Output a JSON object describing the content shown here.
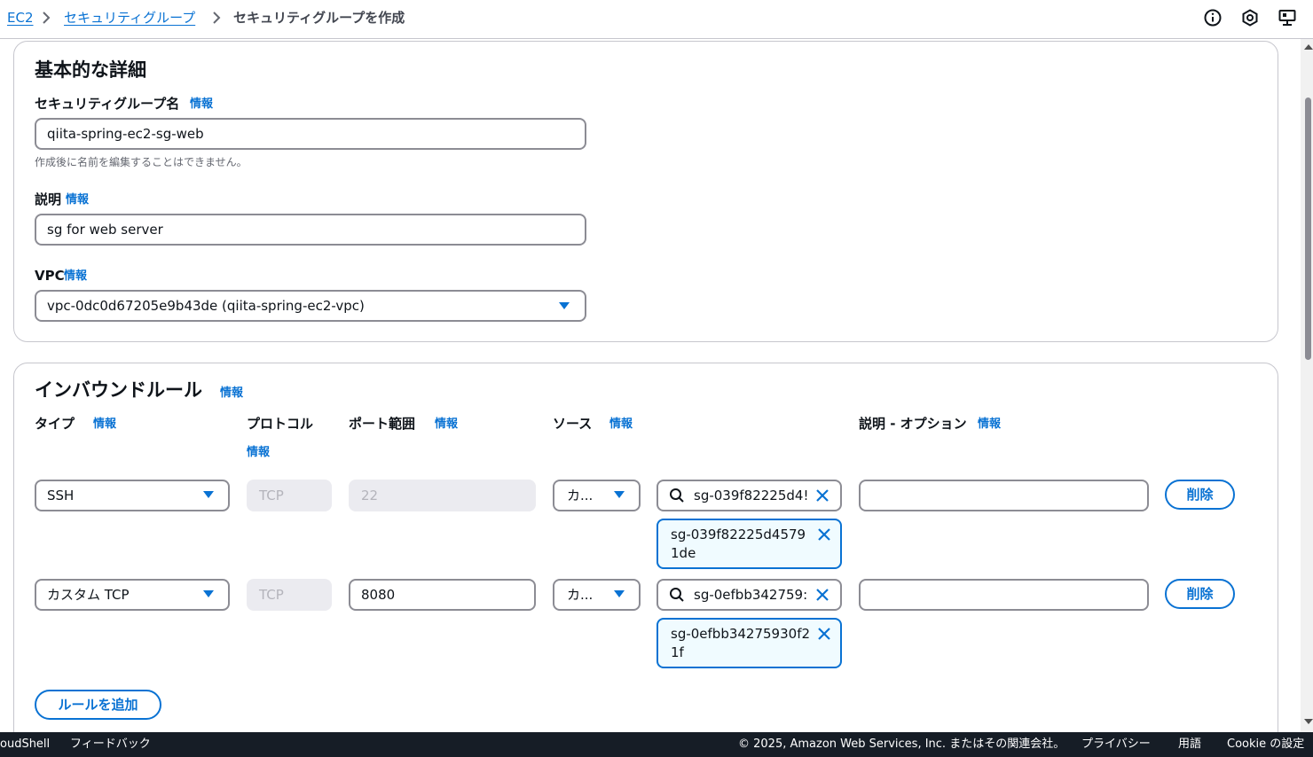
{
  "breadcrumb": {
    "items": [
      "EC2",
      "セキュリティグループ"
    ],
    "current": "セキュリティグループを作成"
  },
  "top_icons": [
    "info-circle-icon",
    "settings-hex-icon",
    "feedback-screen-icon"
  ],
  "basic_details": {
    "title": "基本的な詳細",
    "name_label": "セキュリティグループ名",
    "name_info": "情報",
    "name_value": "qiita-spring-ec2-sg-web",
    "name_hint": "作成後に名前を編集することはできません。",
    "desc_label": "説明",
    "desc_info": "情報",
    "desc_value": "sg for web server",
    "vpc_label": "VPC",
    "vpc_info": "情報",
    "vpc_value": "vpc-0dc0d67205e9b43de (qiita-spring-ec2-vpc)"
  },
  "inbound": {
    "title": "インバウンドルール",
    "title_info": "情報",
    "columns": {
      "type": "タイプ",
      "type_info": "情報",
      "protocol": "プロトコル",
      "protocol_info": "情報",
      "port": "ポート範囲",
      "port_info": "情報",
      "source": "ソース",
      "source_info": "情報",
      "desc": "説明 - オプション",
      "desc_info": "情報"
    },
    "rules": [
      {
        "type": "SSH",
        "protocol": "TCP",
        "port": "22",
        "source_type": "カ...",
        "search": "sg-039f82225d4!",
        "token": "sg-039f82225d45791de",
        "description": "",
        "delete": "削除"
      },
      {
        "type": "カスタム TCP",
        "protocol": "TCP",
        "port": "8080",
        "source_type": "カ...",
        "search": "sg-0efbb342759:",
        "token": "sg-0efbb34275930f21f",
        "description": "",
        "delete": "削除"
      }
    ],
    "add_rule": "ルールを追加"
  },
  "footer": {
    "cloudshell": "oudShell",
    "feedback": "フィードバック",
    "copyright": "© 2025, Amazon Web Services, Inc. またはその関連会社。",
    "privacy": "プライバシー",
    "terms": "用語",
    "cookie": "Cookie の設定"
  },
  "colors": {
    "accent": "#0972d3",
    "token_bg": "#f0fbff",
    "footer_bg": "#161d26",
    "border": "#8c8c94"
  }
}
